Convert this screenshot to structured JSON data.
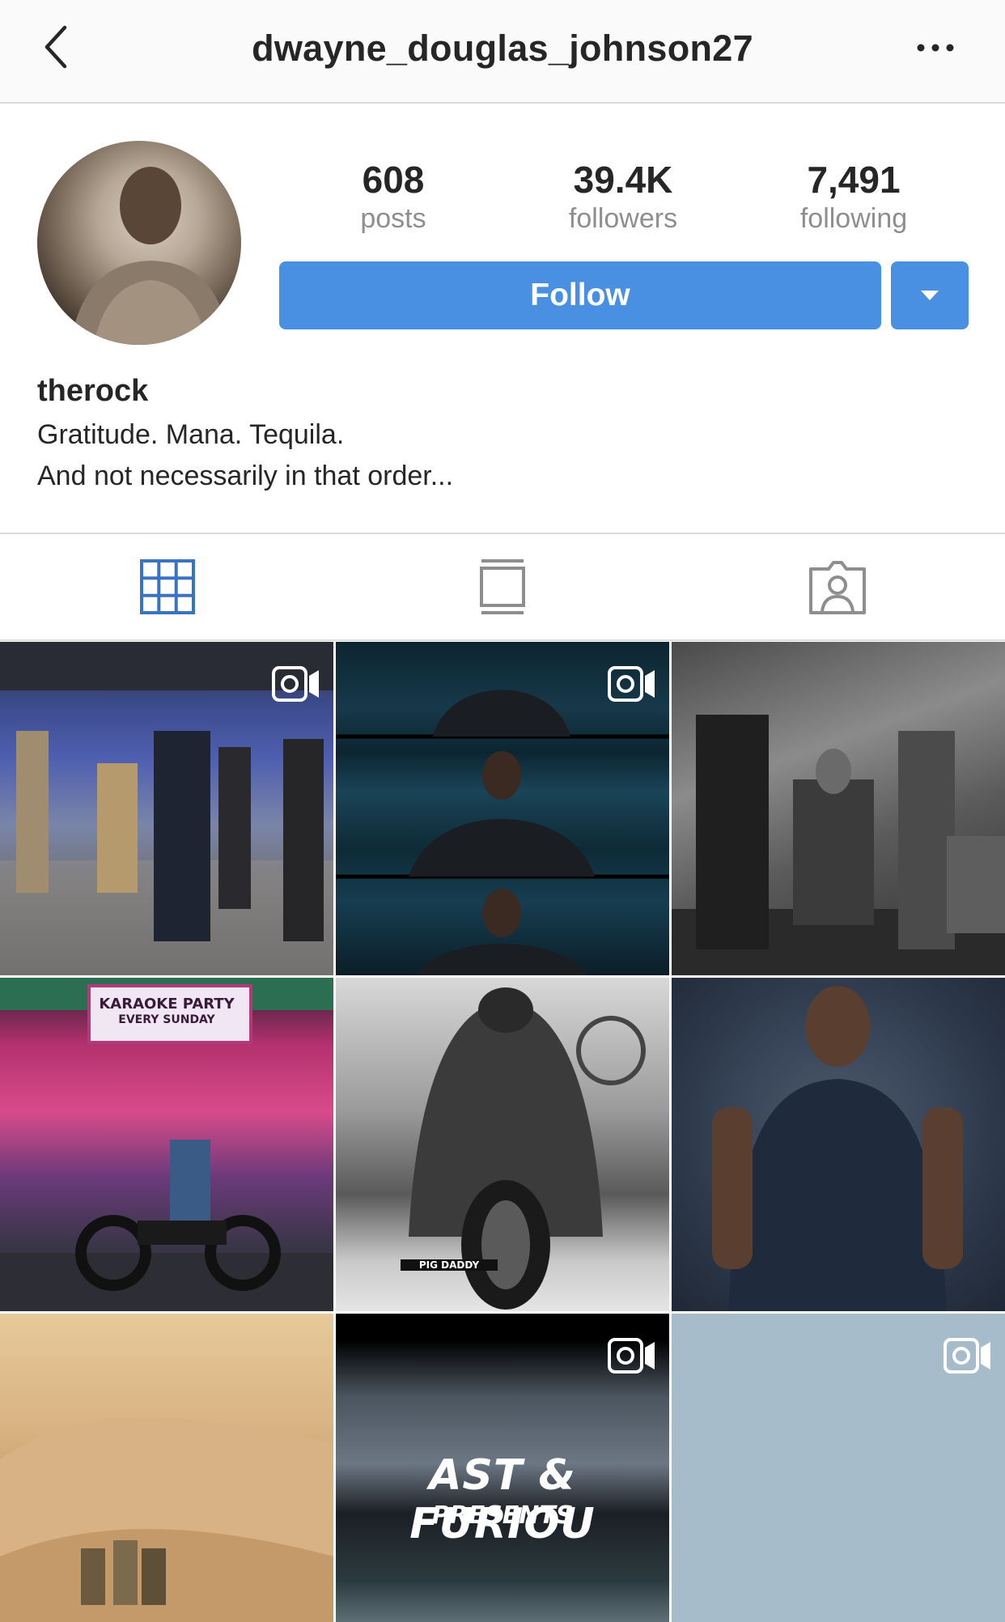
{
  "header": {
    "title": "dwayne_douglas_johnson27",
    "back_icon": "chevron-left-icon",
    "more_icon": "more-horizontal-icon"
  },
  "profile": {
    "stats": [
      {
        "value": "608",
        "label": "posts"
      },
      {
        "value": "39.4K",
        "label": "followers"
      },
      {
        "value": "7,491",
        "label": "following"
      }
    ],
    "follow_label": "Follow",
    "username": "therock",
    "bio": [
      "Gratitude. Mana. Tequila.",
      "And not necessarily in that order..."
    ],
    "accent_color": "#4a90e2"
  },
  "tabs": [
    {
      "icon": "grid-icon",
      "active": true
    },
    {
      "icon": "feed-icon",
      "active": false
    },
    {
      "icon": "tagged-icon",
      "active": false
    }
  ],
  "posts": [
    {
      "type": "video"
    },
    {
      "type": "video"
    },
    {
      "type": "photo"
    },
    {
      "type": "photo",
      "text": [
        "KARAOKE PARTY",
        "EVERY SUNDAY"
      ]
    },
    {
      "type": "photo",
      "text": [
        "PIG DADDY"
      ]
    },
    {
      "type": "photo"
    },
    {
      "type": "photo"
    },
    {
      "type": "video",
      "text": [
        "AST & FURIOU",
        "PRESENTS"
      ]
    },
    {
      "type": "video"
    }
  ]
}
